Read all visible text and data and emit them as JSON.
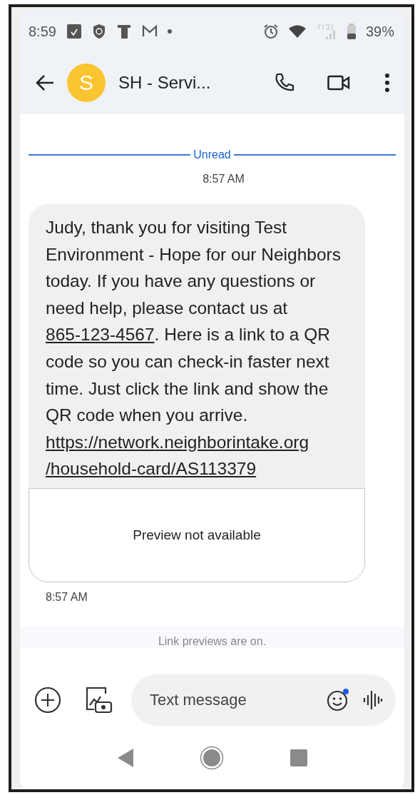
{
  "status_bar": {
    "time": "8:59",
    "battery": "39%"
  },
  "header": {
    "avatar_letter": "S",
    "title": "SH - Servi..."
  },
  "divider_label": "Unread",
  "timestamp": "8:57 AM",
  "message": {
    "parts": [
      {
        "kind": "plain",
        "text": "Judy, thank you for visiting Test Environment - Hope for our Neighbors today. If you have any questions or need help, please contact us at "
      },
      {
        "kind": "link",
        "text": "865-123-4567"
      },
      {
        "kind": "plain",
        "text": ". Here is a link to a QR code so you can check-in faster next time. Just click the link and show the QR code when you arrive."
      }
    ],
    "url_lines": [
      "https://network.neighborintake.org",
      "/household-card/AS113379"
    ],
    "preview": "Preview not available",
    "time": "8:57 AM"
  },
  "notice": "Link previews are on.",
  "composer": {
    "placeholder": "Text message"
  }
}
